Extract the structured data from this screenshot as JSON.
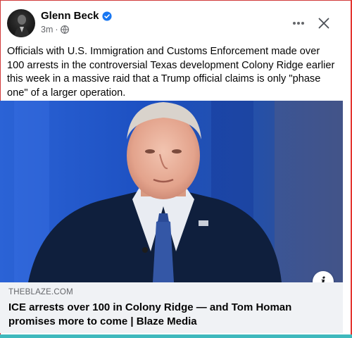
{
  "post": {
    "author": "Glenn Beck",
    "time": "3m",
    "separator": "·",
    "text": "Officials with U.S. Immigration and Customs Enforcement made over 100 arrests in the controversial Texas development Colony Ridge earlier this week in a massive raid that a Trump official claims is only \"phase one\" of a larger operation.",
    "icons": {
      "verified": "verified-badge-icon",
      "audience": "globe-icon",
      "more": "more-options-icon",
      "close": "close-icon",
      "info": "info-icon"
    }
  },
  "link_preview": {
    "domain": "THEBLAZE.COM",
    "title": "ICE arrests over 100 in Colony Ridge — and Tom Homan promises more to come | Blaze Media",
    "info_glyph": "i"
  },
  "colors": {
    "verified": "#1877f2",
    "secondary_text": "#65676b",
    "link_box_bg": "#f0f2f5",
    "media_bg": "#1b4fb8"
  }
}
